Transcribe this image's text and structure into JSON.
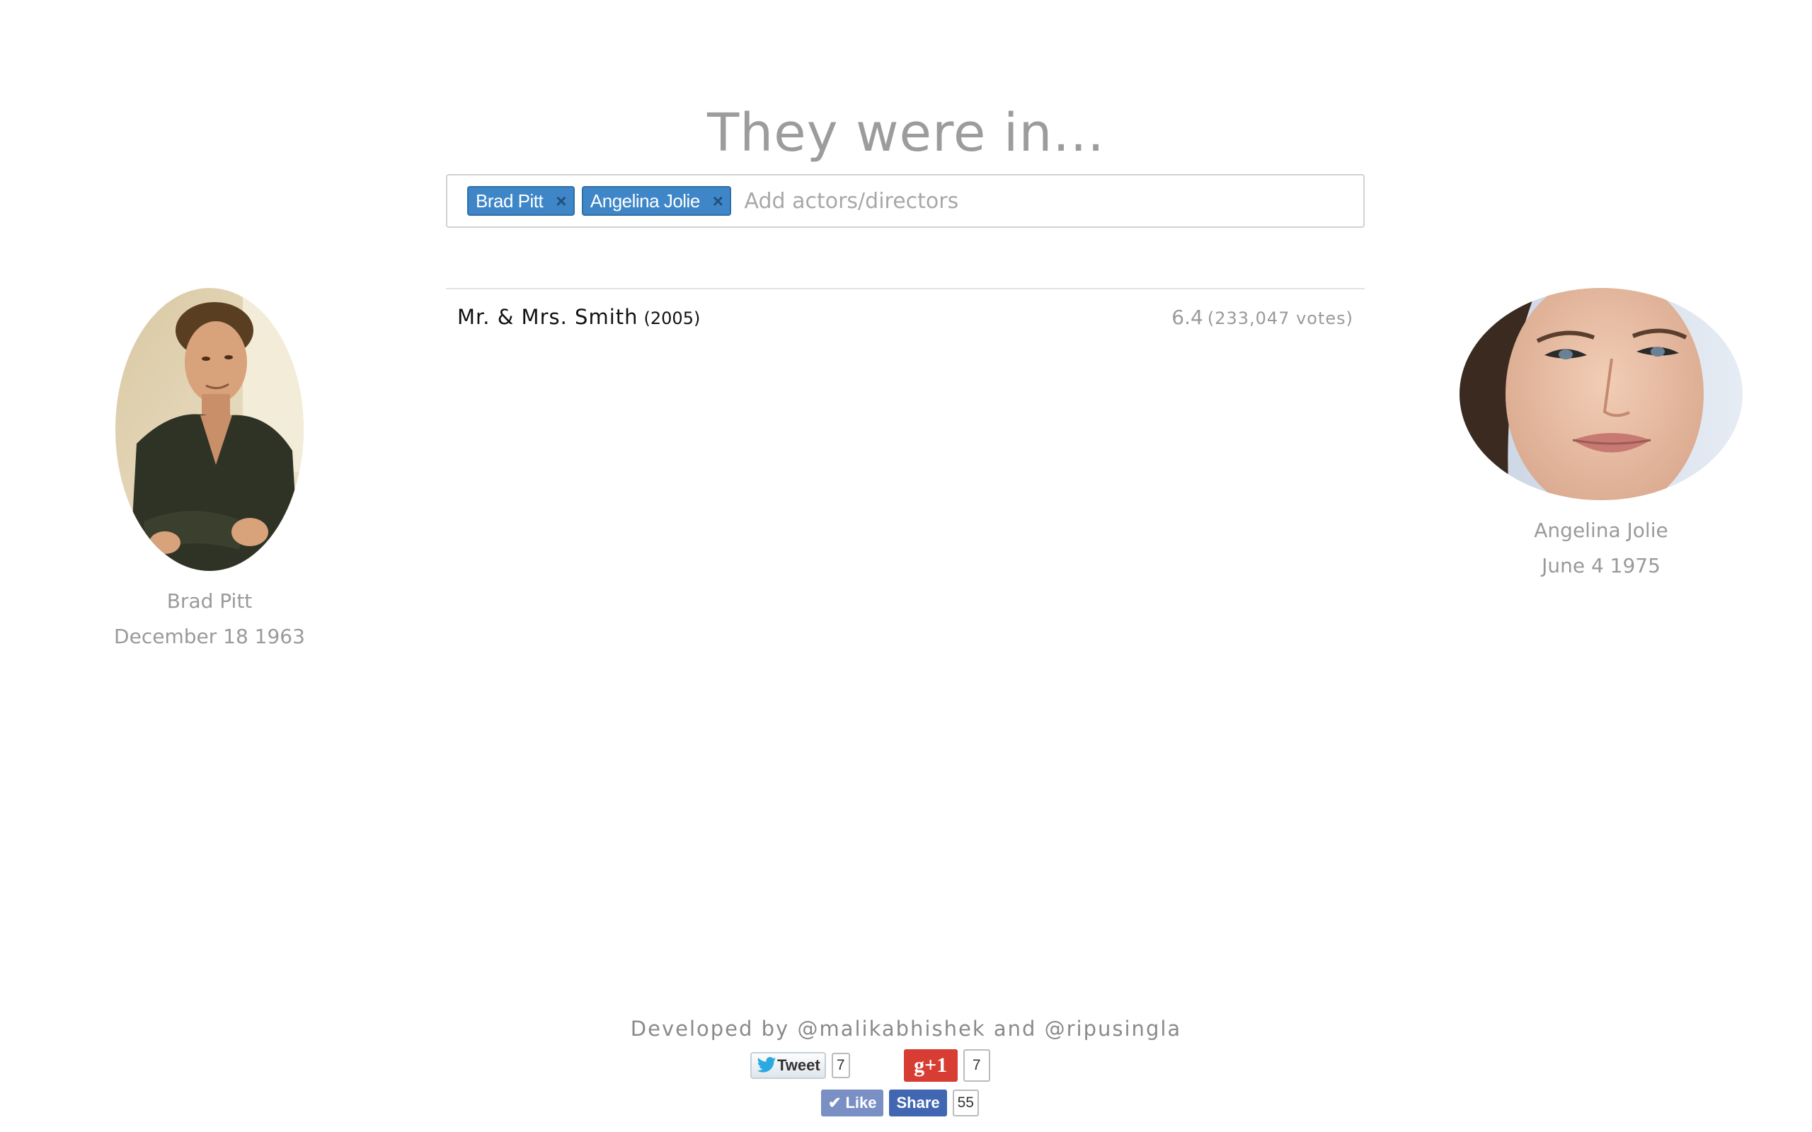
{
  "header": {
    "title": "They were in..."
  },
  "search": {
    "tags": [
      {
        "label": "Brad Pitt",
        "remove": "×"
      },
      {
        "label": "Angelina Jolie",
        "remove": "×"
      }
    ],
    "placeholder": "Add actors/directors"
  },
  "results": [
    {
      "title": "Mr. & Mrs. Smith",
      "year": "(2005)",
      "rating": "6.4",
      "votes": "(233,047 votes)"
    }
  ],
  "people": {
    "left": {
      "name": "Brad Pitt",
      "dob": "December 18 1963"
    },
    "right": {
      "name": "Angelina Jolie",
      "dob": "June 4 1975"
    }
  },
  "footer": {
    "prefix": "Developed by",
    "handle1": "@malikabhishek",
    "conjunction": "and",
    "handle2": "@ripusingla"
  },
  "social": {
    "tweet_label": "Tweet",
    "tweet_count": "7",
    "gplus_label": "g+1",
    "gplus_count": "7",
    "like_label": "Like",
    "share_label": "Share",
    "fb_count": "55"
  },
  "colors": {
    "tag_bg": "#3e86c7",
    "title_text": "#9c9c9c",
    "gplus_red": "#d73d32",
    "fb_blue": "#4267b2"
  }
}
